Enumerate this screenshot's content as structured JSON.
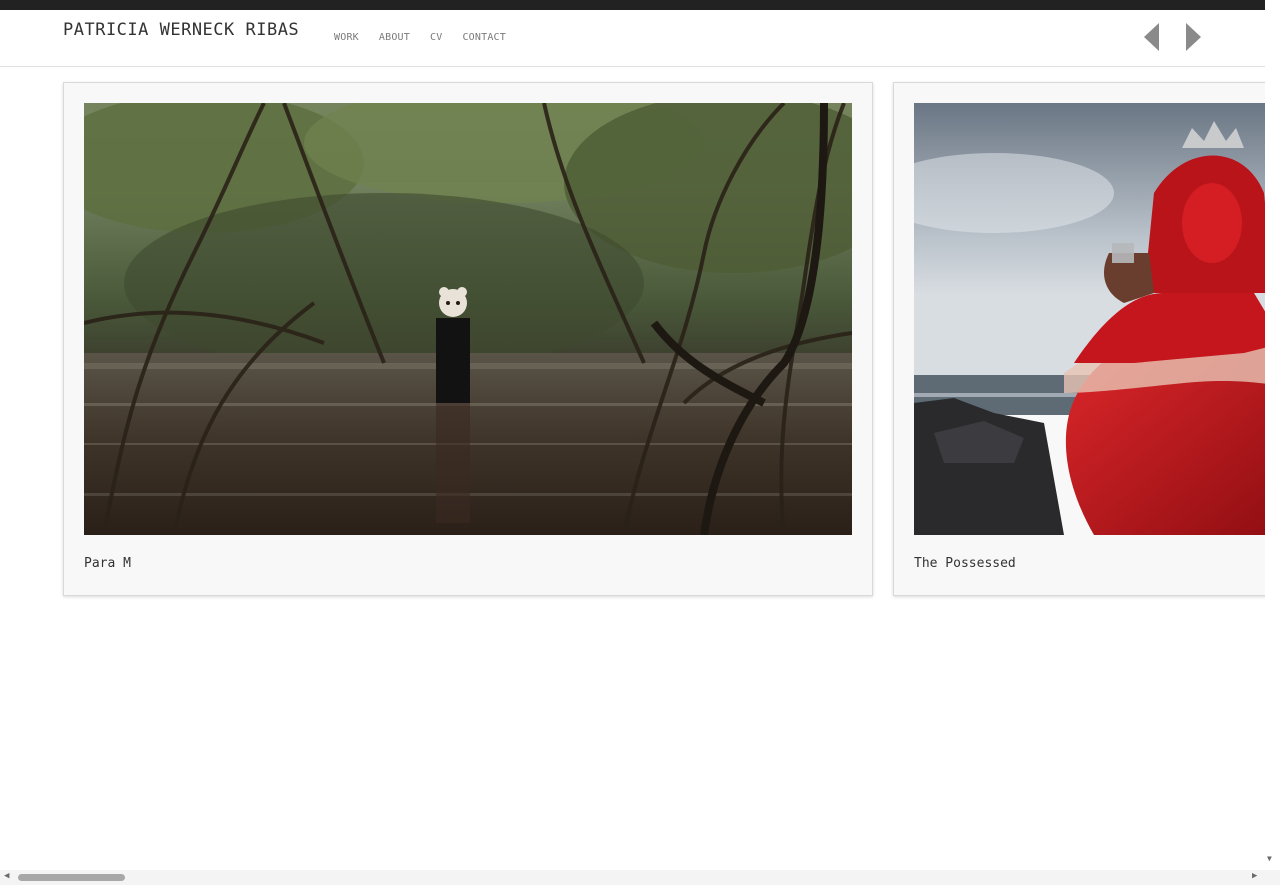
{
  "site": {
    "title": "PATRICIA WERNECK RIBAS"
  },
  "nav": {
    "items": [
      {
        "label": "WORK"
      },
      {
        "label": "ABOUT"
      },
      {
        "label": "CV"
      },
      {
        "label": "CONTACT"
      }
    ]
  },
  "gallery": {
    "prev_icon": "triangle-left-icon",
    "next_icon": "triangle-right-icon",
    "cards": [
      {
        "caption": "Para M",
        "image_subject": "masked figure standing in water among mangrove trees"
      },
      {
        "caption": "The Possessed",
        "image_subject": "figure in red dress and silver crown by the sea"
      }
    ]
  },
  "colors": {
    "top_strip": "#222222",
    "title": "#333333",
    "nav": "#7a7a7a",
    "arrows": "#8a8a8a",
    "card_bg": "#f8f8f8",
    "card_border": "#d9d9d9"
  }
}
